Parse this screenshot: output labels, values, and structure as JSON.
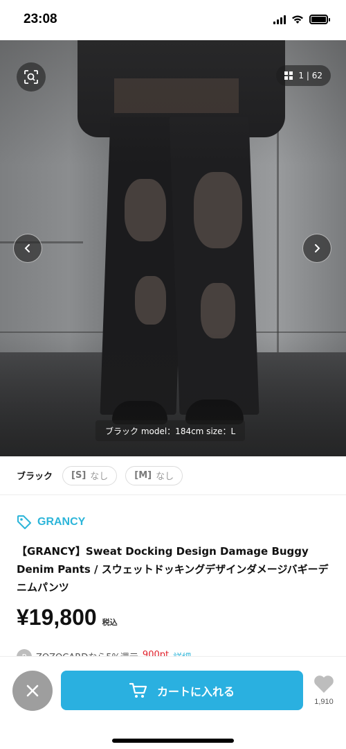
{
  "status_bar": {
    "time": "23:08"
  },
  "gallery": {
    "counter": "1 | 62",
    "caption": "ブラック model：184cm size：L"
  },
  "variants": {
    "color_label": "ブラック",
    "sizes": [
      {
        "label": "[S]",
        "stock": "なし"
      },
      {
        "label": "[M]",
        "stock": "なし"
      }
    ]
  },
  "product": {
    "brand": "GRANCY",
    "title": "【GRANCY】Sweat Docking Design Damage Buggy Denim Pants / スウェットドッキングデザインダメージバギーデニムパンツ",
    "price": "¥19,800",
    "tax_label": "税込"
  },
  "promo": {
    "badge": "P",
    "text": "ZOZOCARDなら5%還元",
    "points": "900pt",
    "link": "詳細"
  },
  "bottom_bar": {
    "cart_label": "カートに入れる",
    "favorite_count": "1,910"
  },
  "colors": {
    "accent": "#2ab0e0",
    "brand_text": "#2cb5d9",
    "close_button": "#9e9e9e",
    "points_red": "#e0212b"
  }
}
